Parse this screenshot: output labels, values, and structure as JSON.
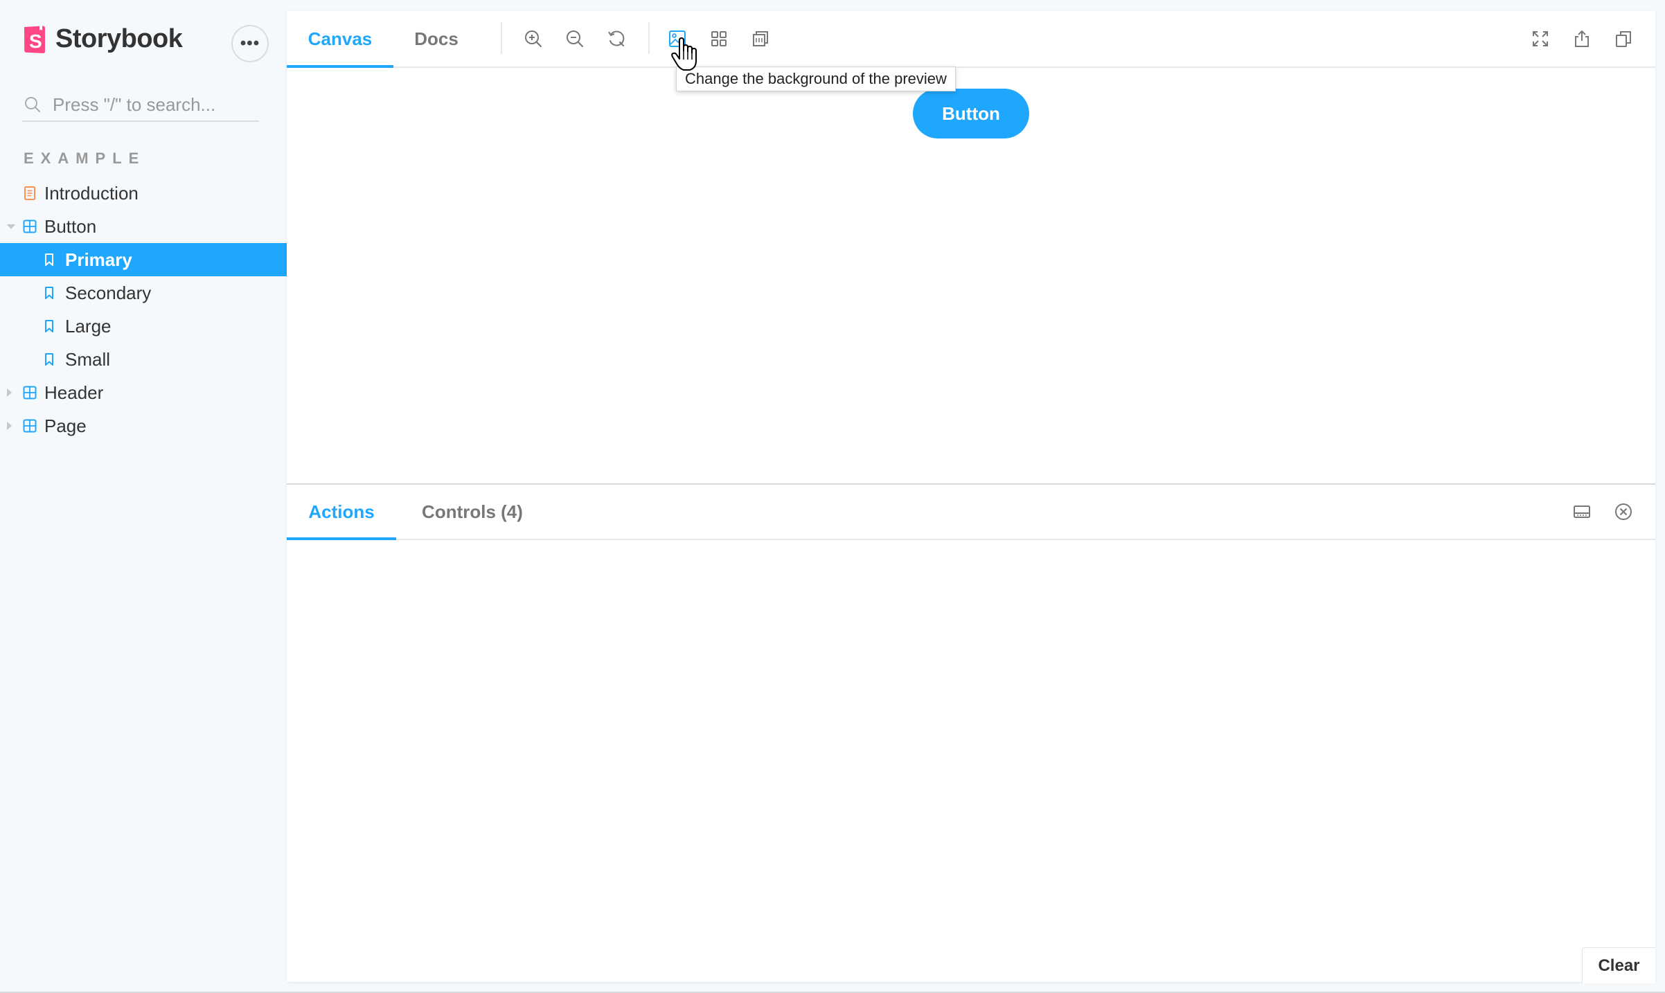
{
  "sidebar": {
    "brand": "Storybook",
    "brand_color": "#ff4785",
    "menu_label": "•••",
    "search_placeholder": "Press \"/\" to search...",
    "section": "EXAMPLE",
    "items": [
      {
        "label": "Introduction",
        "icon": "document-icon",
        "level": 0
      },
      {
        "label": "Button",
        "icon": "component-icon",
        "level": 0,
        "expanded": true
      },
      {
        "label": "Primary",
        "icon": "bookmark-icon",
        "level": 1,
        "selected": true
      },
      {
        "label": "Secondary",
        "icon": "bookmark-icon",
        "level": 1
      },
      {
        "label": "Large",
        "icon": "bookmark-icon",
        "level": 1
      },
      {
        "label": "Small",
        "icon": "bookmark-icon",
        "level": 1
      },
      {
        "label": "Header",
        "icon": "component-icon",
        "level": 0,
        "expanded": false
      },
      {
        "label": "Page",
        "icon": "component-icon",
        "level": 0,
        "expanded": false
      }
    ]
  },
  "toolbar": {
    "tabs": [
      "Canvas",
      "Docs"
    ],
    "active_tab": "Canvas",
    "tools": [
      "zoom-in-icon",
      "zoom-out-icon",
      "reset-zoom-icon",
      "background-icon",
      "grid-icon",
      "measure-icon"
    ],
    "right_tools": [
      "fullscreen-icon",
      "share-icon",
      "copy-link-icon"
    ],
    "tooltip": "Change the background of the preview"
  },
  "preview": {
    "button_label": "Button"
  },
  "panel": {
    "tabs": [
      "Actions",
      "Controls (4)"
    ],
    "active_tab": "Actions",
    "clear_label": "Clear"
  },
  "colors": {
    "accent": "#1ea7fd",
    "sidebar_bg": "#f6f9fc",
    "doc_icon": "#ff8f52"
  }
}
